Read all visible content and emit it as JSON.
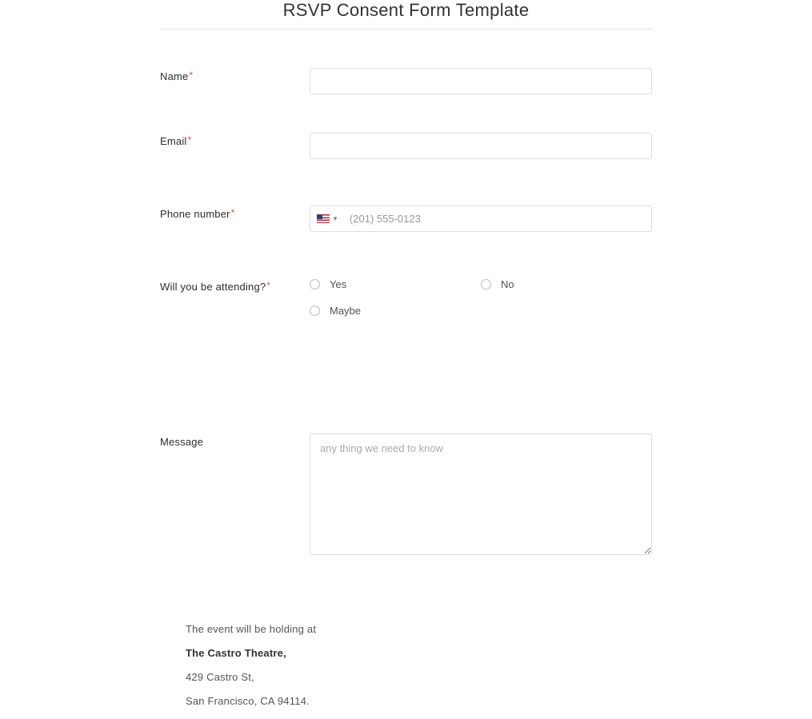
{
  "title": "RSVP Consent Form Template",
  "fields": {
    "name": {
      "label": "Name"
    },
    "email": {
      "label": "Email"
    },
    "phone": {
      "label": "Phone number",
      "placeholder": "(201) 555-0123"
    },
    "attending": {
      "label": "Will you be attending?",
      "options": {
        "yes": "Yes",
        "no": "No",
        "maybe": "Maybe"
      }
    },
    "message": {
      "label": "Message",
      "placeholder": "any thing we need to know"
    }
  },
  "event": {
    "intro": "The event will be holding at",
    "venue": "The Castro Theatre,",
    "street": "429 Castro St,",
    "city": "San Francisco, CA 94114."
  }
}
